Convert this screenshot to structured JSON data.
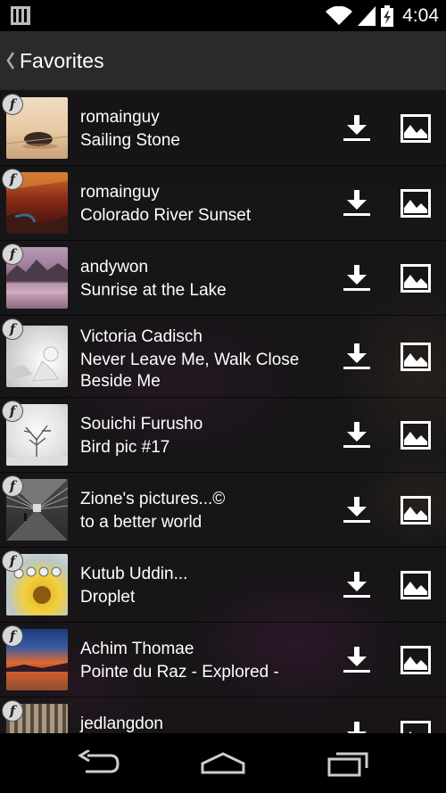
{
  "status_bar": {
    "time": "4:04",
    "icons": [
      "gallery-notification-icon",
      "wifi-icon",
      "signal-icon",
      "battery-charging-icon"
    ]
  },
  "action_bar": {
    "title": "Favorites",
    "up_icon": "chevron-left-icon"
  },
  "favorites": [
    {
      "author": "romainguy",
      "title": "Sailing Stone",
      "badge": "f"
    },
    {
      "author": "romainguy",
      "title": "Colorado River Sunset",
      "badge": "f"
    },
    {
      "author": "andywon",
      "title": "Sunrise at the Lake",
      "badge": "f"
    },
    {
      "author": "Victoria Cadisch",
      "title": "Never Leave Me, Walk Close Beside Me",
      "badge": "f"
    },
    {
      "author": "Souichi Furusho",
      "title": "Bird pic #17",
      "badge": "f"
    },
    {
      "author": "Zione's pictures...©",
      "title": "to a better world",
      "badge": "f"
    },
    {
      "author": "Kutub Uddin...",
      "title": "Droplet",
      "badge": "f"
    },
    {
      "author": "Achim Thomae",
      "title": "Pointe du Raz - Explored -",
      "badge": "f"
    },
    {
      "author": "jedlangdon",
      "title": "",
      "badge": "f"
    }
  ],
  "row_actions": {
    "download_icon": "download-icon",
    "set_wallpaper_icon": "image-icon"
  },
  "nav_bar": {
    "icons": [
      "back-icon",
      "home-icon",
      "recent-apps-icon"
    ]
  },
  "colors": {
    "status_bar": "#000000",
    "action_bar": "#2a2a2a",
    "row_background": "#161616",
    "badge": "#d8d8d8"
  }
}
